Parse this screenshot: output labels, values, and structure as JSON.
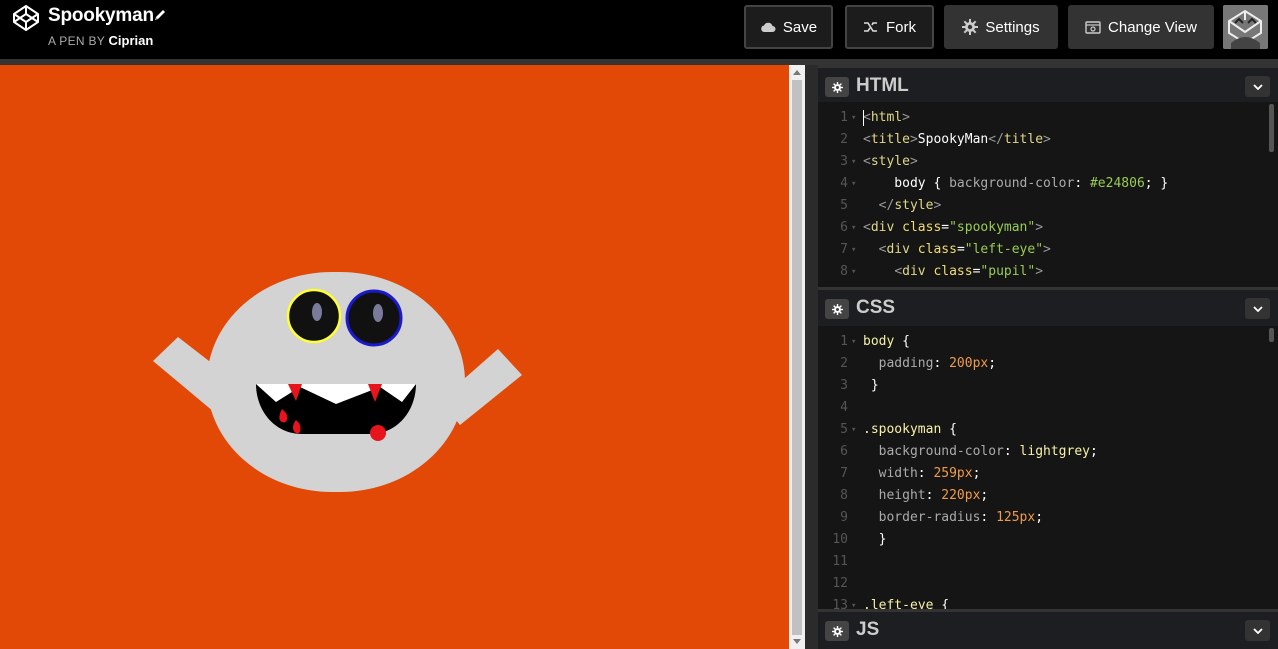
{
  "header": {
    "pen_title": "Spookyman",
    "byline_prefix": "A PEN BY",
    "author": "Ciprian",
    "buttons": {
      "save": "Save",
      "fork": "Fork",
      "settings": "Settings",
      "change_view": "Change View"
    }
  },
  "colors": {
    "preview_bg": "#e24806",
    "ghost_body": "#d3d3d3",
    "left_eye_ring": "#ffff33",
    "right_eye_ring": "#1a1acc",
    "pupil": "#7a7a9a",
    "blood": "#e8141c"
  },
  "editors": {
    "html": {
      "label": "HTML",
      "lines": [
        {
          "n": "1",
          "fold": true,
          "parts": [
            [
              "tagb",
              "<"
            ],
            [
              "tag",
              "html"
            ],
            [
              "tagb",
              ">"
            ]
          ]
        },
        {
          "n": "2",
          "fold": false,
          "parts": [
            [
              "tagb",
              "<"
            ],
            [
              "tag",
              "title"
            ],
            [
              "tagb",
              ">"
            ],
            [
              "txtw",
              "SpookyMan"
            ],
            [
              "tagb",
              "</"
            ],
            [
              "tag",
              "title"
            ],
            [
              "tagb",
              ">"
            ]
          ]
        },
        {
          "n": "3",
          "fold": true,
          "parts": [
            [
              "tagb",
              "<"
            ],
            [
              "tag",
              "style"
            ],
            [
              "tagb",
              ">"
            ]
          ]
        },
        {
          "n": "4",
          "fold": true,
          "parts": [
            [
              "txtw",
              "    body { "
            ],
            [
              "prop",
              "background-color"
            ],
            [
              "txtw",
              ": "
            ],
            [
              "str",
              "#e24806"
            ],
            [
              "txtw",
              "; }"
            ]
          ]
        },
        {
          "n": "5",
          "fold": false,
          "parts": [
            [
              "txtw",
              "  "
            ],
            [
              "tagb",
              "</"
            ],
            [
              "tag",
              "style"
            ],
            [
              "tagb",
              ">"
            ]
          ]
        },
        {
          "n": "6",
          "fold": true,
          "parts": [
            [
              "tagb",
              "<"
            ],
            [
              "tag",
              "div "
            ],
            [
              "attr",
              "class"
            ],
            [
              "txtw",
              "="
            ],
            [
              "str",
              "\"spookyman\""
            ],
            [
              "tagb",
              ">"
            ]
          ]
        },
        {
          "n": "7",
          "fold": true,
          "parts": [
            [
              "txtw",
              "  "
            ],
            [
              "tagb",
              "<"
            ],
            [
              "tag",
              "div "
            ],
            [
              "attr",
              "class"
            ],
            [
              "txtw",
              "="
            ],
            [
              "str",
              "\"left-eye\""
            ],
            [
              "tagb",
              ">"
            ]
          ]
        },
        {
          "n": "8",
          "fold": true,
          "parts": [
            [
              "txtw",
              "    "
            ],
            [
              "tagb",
              "<"
            ],
            [
              "tag",
              "div "
            ],
            [
              "attr",
              "class"
            ],
            [
              "txtw",
              "="
            ],
            [
              "str",
              "\"pupil\""
            ],
            [
              "tagb",
              ">"
            ]
          ]
        }
      ]
    },
    "css": {
      "label": "CSS",
      "lines": [
        {
          "n": "1",
          "fold": true,
          "parts": [
            [
              "sel",
              "body"
            ],
            [
              "brace",
              " {"
            ]
          ]
        },
        {
          "n": "2",
          "fold": false,
          "parts": [
            [
              "txtw",
              "  "
            ],
            [
              "prop",
              "padding"
            ],
            [
              "txtw",
              ": "
            ],
            [
              "val",
              "200px"
            ],
            [
              "txtw",
              ";"
            ]
          ]
        },
        {
          "n": "3",
          "fold": false,
          "parts": [
            [
              "brace",
              " }"
            ]
          ]
        },
        {
          "n": "4",
          "fold": false,
          "parts": []
        },
        {
          "n": "5",
          "fold": true,
          "parts": [
            [
              "sel",
              ".spookyman"
            ],
            [
              "brace",
              " {"
            ]
          ]
        },
        {
          "n": "6",
          "fold": false,
          "parts": [
            [
              "txtw",
              "  "
            ],
            [
              "prop",
              "background-color"
            ],
            [
              "txtw",
              ": "
            ],
            [
              "sel",
              "lightgrey"
            ],
            [
              "txtw",
              ";"
            ]
          ]
        },
        {
          "n": "7",
          "fold": false,
          "parts": [
            [
              "txtw",
              "  "
            ],
            [
              "prop",
              "width"
            ],
            [
              "txtw",
              ": "
            ],
            [
              "val",
              "259px"
            ],
            [
              "txtw",
              ";"
            ]
          ]
        },
        {
          "n": "8",
          "fold": false,
          "parts": [
            [
              "txtw",
              "  "
            ],
            [
              "prop",
              "height"
            ],
            [
              "txtw",
              ": "
            ],
            [
              "val",
              "220px"
            ],
            [
              "txtw",
              ";"
            ]
          ]
        },
        {
          "n": "9",
          "fold": false,
          "parts": [
            [
              "txtw",
              "  "
            ],
            [
              "prop",
              "border-radius"
            ],
            [
              "txtw",
              ": "
            ],
            [
              "val",
              "125px"
            ],
            [
              "txtw",
              ";"
            ]
          ]
        },
        {
          "n": "10",
          "fold": false,
          "parts": [
            [
              "brace",
              "  }"
            ]
          ]
        },
        {
          "n": "11",
          "fold": false,
          "parts": []
        },
        {
          "n": "12",
          "fold": false,
          "parts": []
        },
        {
          "n": "13",
          "fold": true,
          "parts": [
            [
              "sel",
              ".left-eye"
            ],
            [
              "brace",
              " {"
            ]
          ]
        }
      ]
    },
    "js": {
      "label": "JS"
    }
  }
}
